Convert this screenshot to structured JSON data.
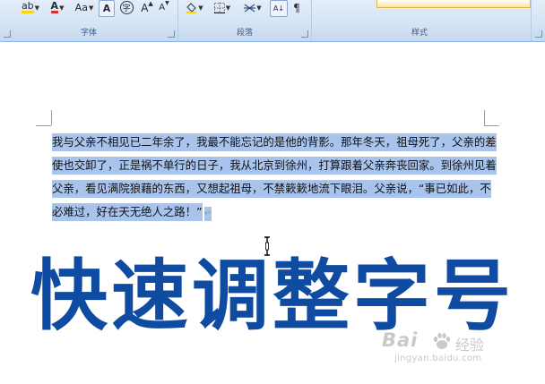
{
  "ribbon": {
    "groups": {
      "font": {
        "label": "字体"
      },
      "paragraph": {
        "label": "段落"
      },
      "styles": {
        "label": "样式"
      }
    },
    "font_buttons": {
      "highlight": "ab",
      "font_color": "A",
      "change_case": "Aa",
      "char_border": "A",
      "enclose_char": "字",
      "grow_font": "A",
      "shrink_font": "A"
    },
    "paragraph_buttons": {
      "sort": "A↓",
      "show_marks": "¶"
    },
    "colors": {
      "highlight_bar": "#ffd400",
      "font_color_bar": "#e0302a"
    }
  },
  "document": {
    "lines": [
      "我与父亲不相见已二年余了，我最不能忘记的是他的背影。那年冬天，祖母死了，父亲的差",
      "使也交卸了，正是祸不单行的日子，我从北京到徐州，打算跟着父亲奔丧回家。到徐州见着",
      "父亲，看见满院狼藉的东西，又想起祖母，不禁簌簌地流下眼泪。父亲说，“事已如此，不",
      "必难过，好在天无绝人之路！”"
    ],
    "paragraph_mark": "↵",
    "selection_color": "#a8c3ec"
  },
  "overlay": {
    "title": "快速调整字号",
    "color": "#0f4ca1"
  },
  "watermark": {
    "brand": "Bai",
    "brand_cn": "经验",
    "url": "jingyan.baidu.com"
  }
}
